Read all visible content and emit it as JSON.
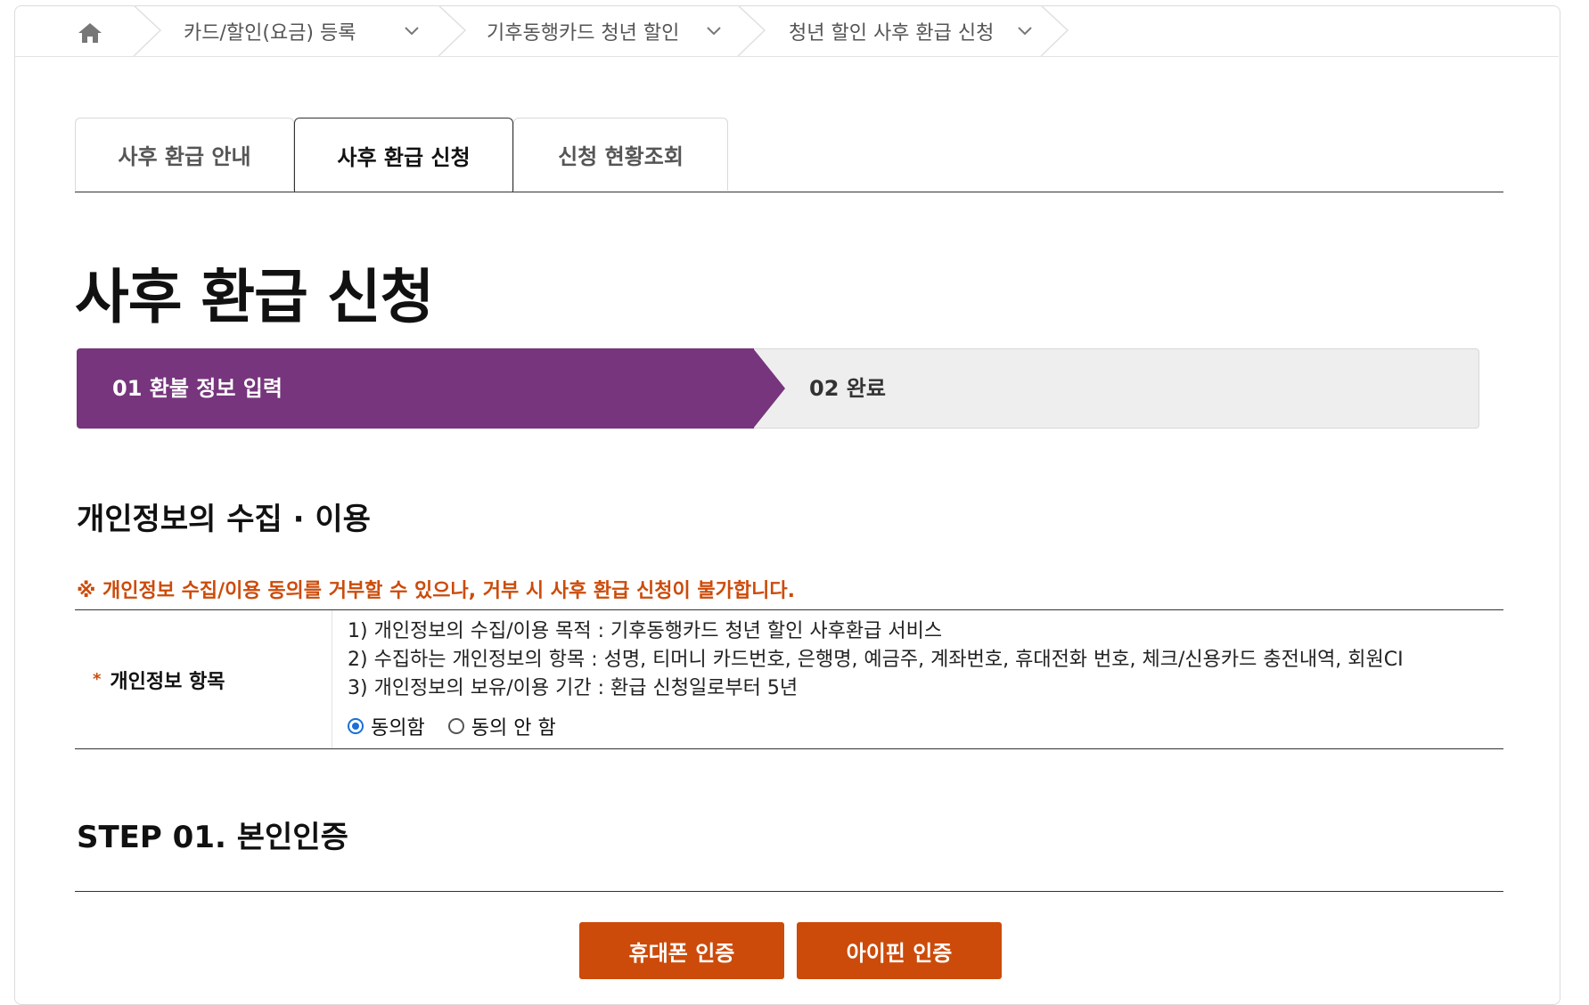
{
  "breadcrumb": {
    "home_icon": "home-icon",
    "items": [
      "카드/할인(요금) 등록",
      "기후동행카드 청년 할인",
      "청년 할인 사후 환급 신청"
    ]
  },
  "tabs": [
    {
      "label": "사후 환급 안내",
      "active": false
    },
    {
      "label": "사후 환급 신청",
      "active": true
    },
    {
      "label": "신청 현황조회",
      "active": false
    }
  ],
  "page_title": "사후 환급 신청",
  "steps": {
    "step1": "01 환불 정보 입력",
    "step2": "02 완료",
    "active_color": "#76357c"
  },
  "privacy": {
    "title": "개인정보의 수집 · 이용",
    "notice": "※ 개인정보 수집/이용 동의를 거부할 수 있으나, 거부 시 사후 환급 신청이 불가합니다.",
    "row_header_star": "*",
    "row_header": "개인정보 항목",
    "lines": [
      "1) 개인정보의 수집/이용 목적 : 기후동행카드 청년 할인 사후환급 서비스",
      "2) 수집하는 개인정보의 항목 : 성명, 티머니 카드번호, 은행명, 예금주, 계좌번호, 휴대전화 번호, 체크/신용카드 충전내역, 회원CI",
      "3) 개인정보의 보유/이용 기간 : 환급 신청일로부터 5년"
    ],
    "agree_label": "동의함",
    "disagree_label": "동의 안 함",
    "selected": "agree"
  },
  "step01": {
    "title": "STEP 01. 본인인증",
    "phone_button": "휴대폰 인증",
    "ipin_button": "아이핀 인증",
    "button_color": "#cc4b0a"
  }
}
